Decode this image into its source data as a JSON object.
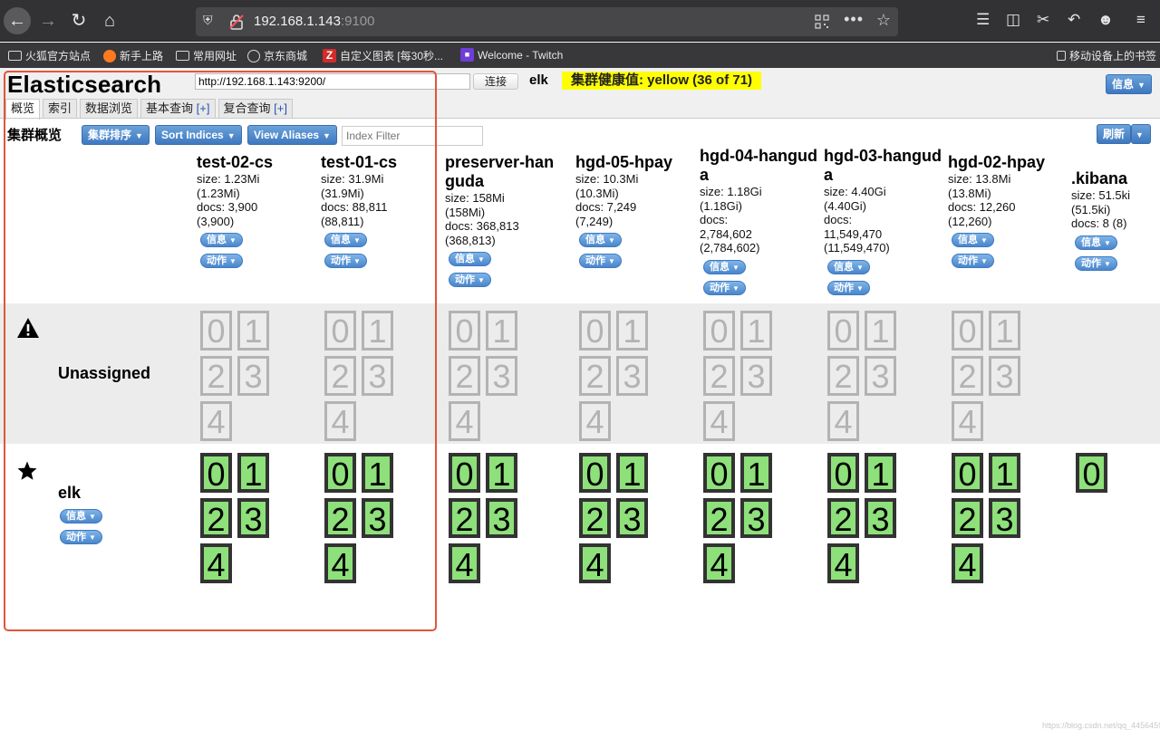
{
  "browser": {
    "url_host": "192.168.1.143",
    "url_port": ":9100",
    "bookmarks": [
      "火狐官方站点",
      "新手上路",
      "常用网址",
      "京东商城",
      "自定义图表 [每30秒...",
      "Welcome - Twitch"
    ],
    "mobile_bookmarks": "移动设备上的书签"
  },
  "app": {
    "logo": "Elasticsearch",
    "cluster_url": "http://192.168.1.143:9200/",
    "connect_label": "连接",
    "cluster_name": "elk",
    "health_text": "集群健康值: yellow (36 of 71)",
    "info_label": "信息",
    "tabs": [
      {
        "label": "概览",
        "plus": ""
      },
      {
        "label": "索引",
        "plus": ""
      },
      {
        "label": "数据浏览",
        "plus": ""
      },
      {
        "label": "基本查询 ",
        "plus": "[+]"
      },
      {
        "label": "复合查询 ",
        "plus": "[+]"
      }
    ],
    "overview_title": "集群概览",
    "sort_cluster_label": "集群排序",
    "sort_indices_label": "Sort Indices",
    "view_aliases_label": "View Aliases",
    "index_filter_placeholder": "Index Filter",
    "refresh_label": "刷新",
    "pill_info": "信息",
    "pill_action": "动作",
    "unassigned_label": "Unassigned",
    "node_label": "elk",
    "watermark": "https://blog.csdn.net/qq_44564596"
  },
  "indices": [
    {
      "name": "test-02-cs",
      "stats": [
        "size: 1.23Mi",
        "(1.23Mi)",
        "docs: 3,900",
        "(3,900)"
      ],
      "unassigned": [
        "0",
        "1",
        "2",
        "3",
        "4"
      ],
      "assigned": [
        "0",
        "1",
        "2",
        "3",
        "4"
      ]
    },
    {
      "name": "test-01-cs",
      "stats": [
        "size: 31.9Mi",
        "(31.9Mi)",
        "docs: 88,811",
        "(88,811)"
      ],
      "unassigned": [
        "0",
        "1",
        "2",
        "3",
        "4"
      ],
      "assigned": [
        "0",
        "1",
        "2",
        "3",
        "4"
      ]
    },
    {
      "name": "preserver-hanguda",
      "stats": [
        "size: 158Mi",
        "(158Mi)",
        "docs: 368,813",
        "(368,813)"
      ],
      "unassigned": [
        "0",
        "1",
        "2",
        "3",
        "4"
      ],
      "assigned": [
        "0",
        "1",
        "2",
        "3",
        "4"
      ]
    },
    {
      "name": "hgd-05-hpay",
      "stats": [
        "size: 10.3Mi",
        "(10.3Mi)",
        "docs: 7,249",
        "(7,249)"
      ],
      "unassigned": [
        "0",
        "1",
        "2",
        "3",
        "4"
      ],
      "assigned": [
        "0",
        "1",
        "2",
        "3",
        "4"
      ]
    },
    {
      "name": "hgd-04-hanguda",
      "stats": [
        "size: 1.18Gi",
        "(1.18Gi)",
        "docs:",
        "2,784,602",
        "(2,784,602)"
      ],
      "unassigned": [
        "0",
        "1",
        "2",
        "3",
        "4"
      ],
      "assigned": [
        "0",
        "1",
        "2",
        "3",
        "4"
      ]
    },
    {
      "name": "hgd-03-hanguda",
      "stats": [
        "size: 4.40Gi",
        "(4.40Gi)",
        "docs:",
        "11,549,470",
        "(11,549,470)"
      ],
      "unassigned": [
        "0",
        "1",
        "2",
        "3",
        "4"
      ],
      "assigned": [
        "0",
        "1",
        "2",
        "3",
        "4"
      ]
    },
    {
      "name": "hgd-02-hpay",
      "stats": [
        "size: 13.8Mi",
        "(13.8Mi)",
        "docs: 12,260",
        "(12,260)"
      ],
      "unassigned": [
        "0",
        "1",
        "2",
        "3",
        "4"
      ],
      "assigned": [
        "0",
        "1",
        "2",
        "3",
        "4"
      ]
    },
    {
      "name": ".kibana",
      "stats": [
        "size: 51.5ki",
        "(51.5ki)",
        "docs: 8 (8)"
      ],
      "unassigned": [],
      "assigned": [
        "0"
      ]
    }
  ]
}
